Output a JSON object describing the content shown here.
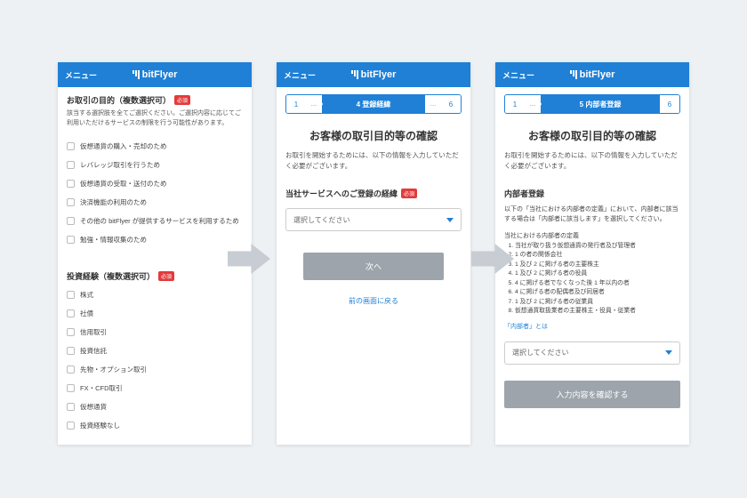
{
  "brand": "bitFlyer",
  "menu_label": "メニュー",
  "required_label": "必須",
  "screen1": {
    "section1": {
      "title": "お取引の目的（複数選択可）",
      "desc": "該当する選択肢を全てご選択ください。ご選択内容に応じてご利用いただけるサービスの制限を行う可能性があります。",
      "options": [
        "仮想通貨の購入・売却のため",
        "レバレッジ取引を行うため",
        "仮想通貨の受取・送付のため",
        "決済機能の利用のため",
        "その他の bitFlyer が提供するサービスを利用するため",
        "勉強・情報収集のため"
      ]
    },
    "section2": {
      "title": "投資経験（複数選択可）",
      "options": [
        "株式",
        "社債",
        "信用取引",
        "投資信託",
        "先物・オプション取引",
        "FX・CFD取引",
        "仮想通貨",
        "投資経験なし"
      ]
    }
  },
  "screen2": {
    "step_left": "1",
    "step_active": "4 登録経緯",
    "step_right": "6",
    "dots": "…",
    "title": "お客様の取引目的等の確認",
    "desc": "お取引を開始するためには、以下の情報を入力していただく必要がございます。",
    "field_label": "当社サービスへのご登録の経緯",
    "select_placeholder": "選択してください",
    "next_button": "次へ",
    "back_link": "前の画面に戻る"
  },
  "screen3": {
    "step_left": "1",
    "step_active": "5 内部者登録",
    "step_right": "6",
    "title": "お客様の取引目的等の確認",
    "desc": "お取引を開始するためには、以下の情報を入力していただく必要がございます。",
    "subhead": "内部者登録",
    "subdesc": "以下の「当社における内部者の定義」において、内部者に該当する場合は「内部者に該当します」を選択してください。",
    "deflabel": "当社における内部者の定義",
    "defs": [
      "当社が取り扱う仮想通貨の発行者及び管理者",
      "1 の者の関係会社",
      "1 及び 2 に掲げる者の主要株主",
      "1 及び 2 に掲げる者の役員",
      "4 に掲げる者でなくなった後 1 年以内の者",
      "4 に掲げる者の配偶者及び同居者",
      "1 及び 2 に掲げる者の従業員",
      "仮想通貨取扱業者の主要株主・役員・従業者"
    ],
    "deflink": "「内部者」とは",
    "select_placeholder": "選択してください",
    "confirm_button": "入力内容を確認する"
  }
}
